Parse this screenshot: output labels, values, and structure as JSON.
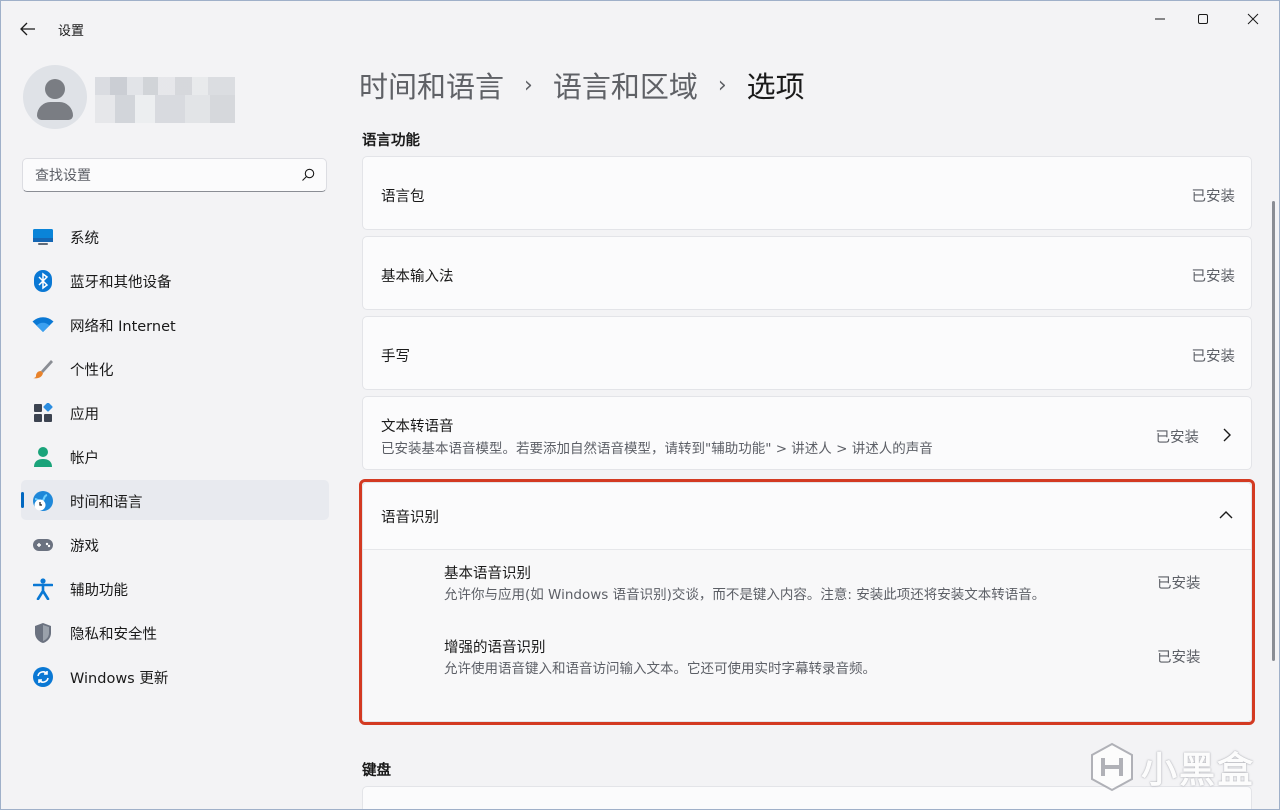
{
  "window": {
    "app_title": "设置",
    "controls": {
      "minimize": "minimize-icon",
      "maximize": "maximize-icon",
      "close": "close-icon"
    }
  },
  "sidebar": {
    "search": {
      "placeholder": "查找设置"
    },
    "items": [
      {
        "label": "系统",
        "icon": "system-icon",
        "selected": false
      },
      {
        "label": "蓝牙和其他设备",
        "icon": "bluetooth-icon",
        "selected": false
      },
      {
        "label": "网络和 Internet",
        "icon": "wifi-icon",
        "selected": false
      },
      {
        "label": "个性化",
        "icon": "brush-icon",
        "selected": false
      },
      {
        "label": "应用",
        "icon": "apps-icon",
        "selected": false
      },
      {
        "label": "帐户",
        "icon": "account-icon",
        "selected": false
      },
      {
        "label": "时间和语言",
        "icon": "time-language-icon",
        "selected": true
      },
      {
        "label": "游戏",
        "icon": "gamepad-icon",
        "selected": false
      },
      {
        "label": "辅助功能",
        "icon": "accessibility-icon",
        "selected": false
      },
      {
        "label": "隐私和安全性",
        "icon": "shield-icon",
        "selected": false
      },
      {
        "label": "Windows 更新",
        "icon": "update-icon",
        "selected": false
      }
    ]
  },
  "breadcrumb": {
    "items": [
      "时间和语言",
      "语言和区域",
      "选项"
    ],
    "separator": "›"
  },
  "sections": {
    "language_features": {
      "title": "语言功能",
      "cards": [
        {
          "title": "语言包",
          "status": "已安装"
        },
        {
          "title": "基本输入法",
          "status": "已安装"
        },
        {
          "title": "手写",
          "status": "已安装"
        },
        {
          "title": "文本转语音",
          "description": "已安装基本语音模型。若要添加自然语音模型，请转到\"辅助功能\" > 讲述人 > 讲述人的声音",
          "status": "已安装"
        }
      ],
      "speech_recognition": {
        "title": "语音识别",
        "expanded": true,
        "items": [
          {
            "title": "基本语音识别",
            "description": "允许你与应用(如 Windows 语音识别)交谈，而不是键入内容。注意: 安装此项还将安装文本转语音。",
            "status": "已安装"
          },
          {
            "title": "增强的语音识别",
            "description": "允许使用语音键入和语音访问输入文本。它还可使用实时字幕转录音频。",
            "status": "已安装"
          }
        ]
      }
    },
    "keyboard": {
      "title": "键盘"
    }
  },
  "watermark": {
    "text": "小黑盒"
  },
  "colors": {
    "accent": "#0067c0",
    "highlight_border": "#d33a22",
    "background": "#f3f3f5",
    "card": "#fbfbfc"
  }
}
